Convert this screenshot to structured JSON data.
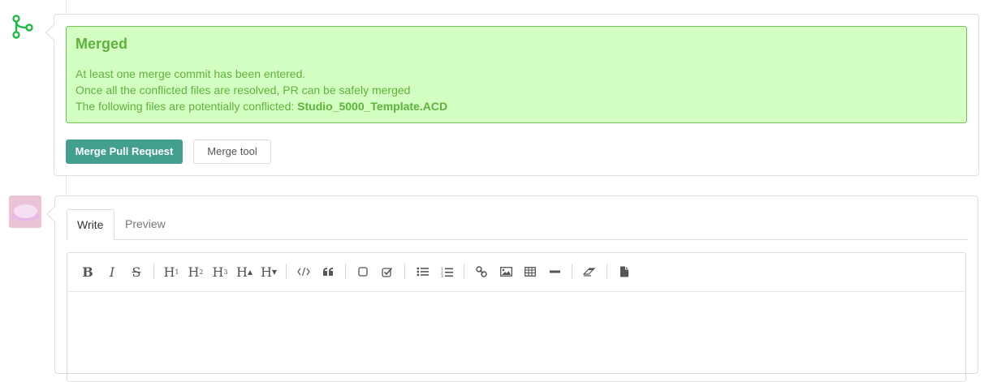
{
  "merge": {
    "title": "Merged",
    "line1": "At least one merge commit has been entered.",
    "line2": "Once all the conflicted files are resolved, PR can be safely merged",
    "line3_prefix": "The following files are potentially conflicted: ",
    "conflicted_file": "Studio_5000_Template.ACD",
    "merge_button": "Merge Pull Request",
    "merge_tool_button": "Merge tool"
  },
  "editor": {
    "tabs": {
      "write": "Write",
      "preview": "Preview"
    },
    "toolbar": {
      "bold": "B",
      "italic": "I",
      "strike": "S",
      "h1": "H",
      "h2": "H",
      "h3": "H",
      "h_bigger": "H",
      "h_smaller": "H",
      "h1_sub": "1",
      "h2_sub": "2",
      "h3_sub": "3",
      "h_bigger_sub": "▲",
      "h_smaller_sub": "▼"
    }
  },
  "colors": {
    "merged_bg": "#d3ffc2",
    "merged_text": "#5fb23c",
    "primary": "#43a08e",
    "merge_icon": "#21ba45"
  }
}
